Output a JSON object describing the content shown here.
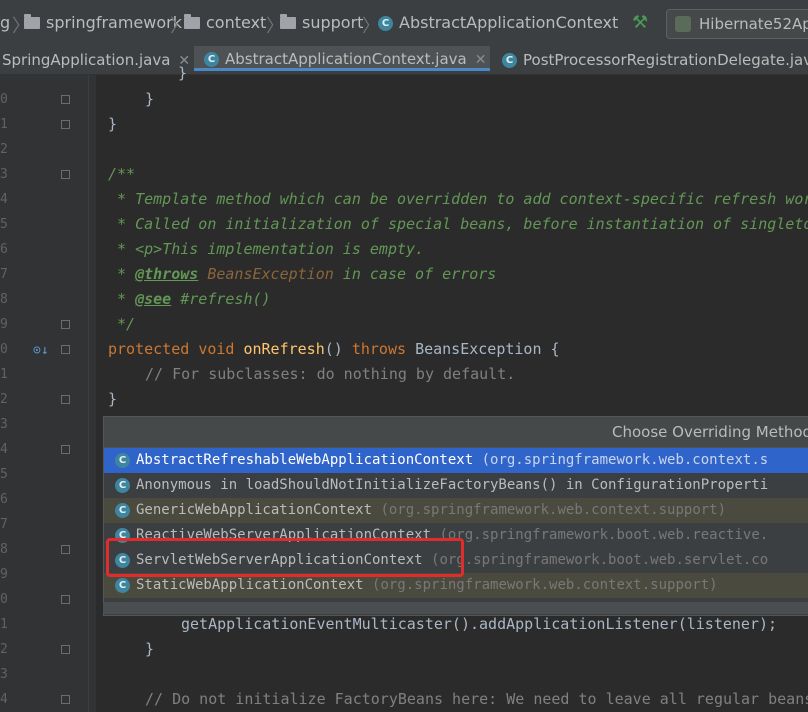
{
  "breadcrumb": {
    "items": [
      "g",
      "springframework",
      "context",
      "support",
      "AbstractApplicationContext"
    ],
    "run_config": "Hibernate52Ap"
  },
  "tabs": [
    {
      "label": "SpringApplication.java",
      "active": false
    },
    {
      "label": "AbstractApplicationContext.java",
      "active": true
    },
    {
      "label": "PostProcessorRegistrationDelegate.java",
      "active": false
    }
  ],
  "gutter": {
    "line_digits": [
      "0",
      "1",
      "2",
      "3",
      "4",
      "5",
      "6",
      "7",
      "8",
      "9",
      "0",
      "1",
      "2",
      "3",
      "4",
      "5",
      "6",
      "7",
      "8",
      "9",
      "0",
      "1",
      "2",
      "3",
      "4"
    ]
  },
  "code": {
    "l0_brace": "}",
    "l1_brace": "}",
    "doc_open": "/**",
    "doc_l1": " * Template method which can be overridden to add context-specific refresh wor",
    "doc_l2": " * Called on initialization of special beans, before instantiation of singleto",
    "doc_l3_tag": "<p>",
    "doc_l3": "This implementation is empty.",
    "doc_l4_tag": "@throws",
    "doc_l4_val": "BeansException",
    "doc_l4": " in case of errors",
    "doc_l5_tag": "@see",
    "doc_l5": " #refresh()",
    "doc_close": " */",
    "sig_kw1": "protected",
    "sig_kw2": "void",
    "sig_fn": "onRefresh",
    "sig_mid": "()",
    "sig_kw3": "throws",
    "sig_rest": "BeansException {",
    "comment1": "// For subclasses: do nothing by default.",
    "close_brace": "}",
    "listener_call": "getApplicationEventMulticaster().addApplicationListener(listener);",
    "close_brace2": "}",
    "comment2": "// Do not initialize FactoryBeans here: We need to leave all regular beans"
  },
  "popup": {
    "title": "Choose Overriding Method",
    "items": [
      {
        "name": "AbstractRefreshableWebApplicationContext",
        "pkg": "(org.springframework.web.context.s"
      },
      {
        "name": "Anonymous in loadShouldNotInitializeFactoryBeans() in ConfigurationProperti",
        "pkg": ""
      },
      {
        "name": "GenericWebApplicationContext",
        "pkg": "(org.springframework.web.context.support)"
      },
      {
        "name": "ReactiveWebServerApplicationContext",
        "pkg": "(org.springframework.boot.web.reactive."
      },
      {
        "name": "ServletWebServerApplicationContext",
        "pkg": "(org.springframework.boot.web.servlet.co"
      },
      {
        "name": "StaticWebApplicationContext",
        "pkg": "(org.springframework.web.context.support)"
      }
    ]
  },
  "colors": {
    "keyword": "#cc7832",
    "function": "#ffc66d",
    "doc_comment": "#629755",
    "selection": "#2f65ca",
    "highlight_box": "#e22c2c"
  }
}
